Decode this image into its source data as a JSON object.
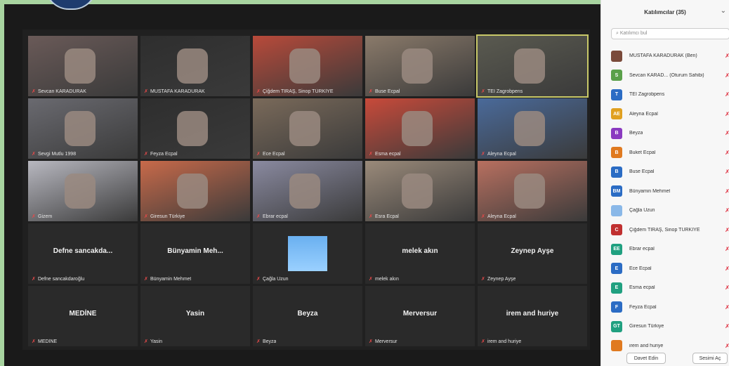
{
  "sidebar": {
    "title": "Katılımcılar (35)",
    "search_placeholder": "Katılımcı bul",
    "invite_label": "Davet Edin",
    "mute_label": "Sesimi Aç",
    "participants": [
      {
        "initials": "",
        "name": "MUSTAFA KARADURAK (Ben)",
        "color": "#7a4a3a"
      },
      {
        "initials": "S",
        "name": "Sevcan KARAD... (Oturum Sahibi)",
        "color": "#5aa04a"
      },
      {
        "initials": "T",
        "name": "TEI Zagrobpens",
        "color": "#2b6cc4"
      },
      {
        "initials": "AE",
        "name": "Aleyna Ecpal",
        "color": "#e0a020"
      },
      {
        "initials": "B",
        "name": "Beyza",
        "color": "#8a3ac0"
      },
      {
        "initials": "B",
        "name": "Buket Ecpal",
        "color": "#e07a20"
      },
      {
        "initials": "B",
        "name": "Buse Ecpal",
        "color": "#2b6cc4"
      },
      {
        "initials": "BM",
        "name": "Bünyamin Mehmet",
        "color": "#2b6cc4"
      },
      {
        "initials": "",
        "name": "Çağla Uzun",
        "color": "#8ab8e8"
      },
      {
        "initials": "C",
        "name": "Çiğdem TIRAŞ, Sinop TÜRKİYE",
        "color": "#c03030"
      },
      {
        "initials": "EE",
        "name": "Ebrar ecpal",
        "color": "#20a080"
      },
      {
        "initials": "E",
        "name": "Ece Ecpal",
        "color": "#2b6cc4"
      },
      {
        "initials": "E",
        "name": "Esma ecpal",
        "color": "#20a080"
      },
      {
        "initials": "F",
        "name": "Feyza Ecpal",
        "color": "#2b6cc4"
      },
      {
        "initials": "GT",
        "name": "Giresun Türkiye",
        "color": "#20a080"
      },
      {
        "initials": "",
        "name": "irem and huriye",
        "color": "#e07a20"
      }
    ]
  },
  "tiles": [
    {
      "name": "Sevcan KARADURAK",
      "kind": "video",
      "bg": "#6a5a58"
    },
    {
      "name": "MUSTAFA KARADURAK",
      "kind": "video",
      "bg": "#2e2e2e"
    },
    {
      "name": "Çiğdem TIRAŞ, Sinop TÜRKİYE",
      "kind": "video",
      "bg": "#b84a3a"
    },
    {
      "name": "Buse Ecpal",
      "kind": "video",
      "bg": "#8a7a6a"
    },
    {
      "name": "TEI Zagrobpens",
      "kind": "video",
      "bg": "#5a5a50"
    },
    {
      "name": "Sevgi Mutlu 1998",
      "kind": "video",
      "bg": "#6a6a70"
    },
    {
      "name": "Feyza Ecpal",
      "kind": "video",
      "bg": "#2e2e2e"
    },
    {
      "name": "Ece Ecpal",
      "kind": "video",
      "bg": "#7a6a5a"
    },
    {
      "name": "Esma ecpal",
      "kind": "video",
      "bg": "#c84a3a"
    },
    {
      "name": "Aleyna Ecpal",
      "kind": "video",
      "bg": "#4a6a9a"
    },
    {
      "name": "Gizem",
      "kind": "video",
      "bg": "#b8b8c0"
    },
    {
      "name": "Giresun Türkiye",
      "kind": "video",
      "bg": "#c86a4a"
    },
    {
      "name": "Ebrar ecpal",
      "kind": "video",
      "bg": "#8a8aa0"
    },
    {
      "name": "Esra Ecpal",
      "kind": "video",
      "bg": "#9a8a7a"
    },
    {
      "name": "Aleyna Ecpal",
      "kind": "video",
      "bg": "#b87060"
    },
    {
      "name": "Defne sancakdaroğlu",
      "big": "Defne sancakda...",
      "kind": "name"
    },
    {
      "name": "Bünyamin Mehmet",
      "big": "Bünyamin Meh...",
      "kind": "name"
    },
    {
      "name": "Çağla Uzun",
      "big": "",
      "kind": "avatar"
    },
    {
      "name": "melek akın",
      "big": "melek akın",
      "kind": "name"
    },
    {
      "name": "Zeynep Ayşe",
      "big": "Zeynep Ayşe",
      "kind": "name"
    },
    {
      "name": "MEDİNE",
      "big": "MEDİNE",
      "kind": "name"
    },
    {
      "name": "Yasin",
      "big": "Yasin",
      "kind": "name"
    },
    {
      "name": "Beyza",
      "big": "Beyza",
      "kind": "name"
    },
    {
      "name": "Merversur",
      "big": "Merversur",
      "kind": "name"
    },
    {
      "name": "irem and huriye",
      "big": "irem and huriye",
      "kind": "name"
    }
  ],
  "colors": {
    "active_border": "#c8c868",
    "mic_muted": "#e84a4a"
  }
}
